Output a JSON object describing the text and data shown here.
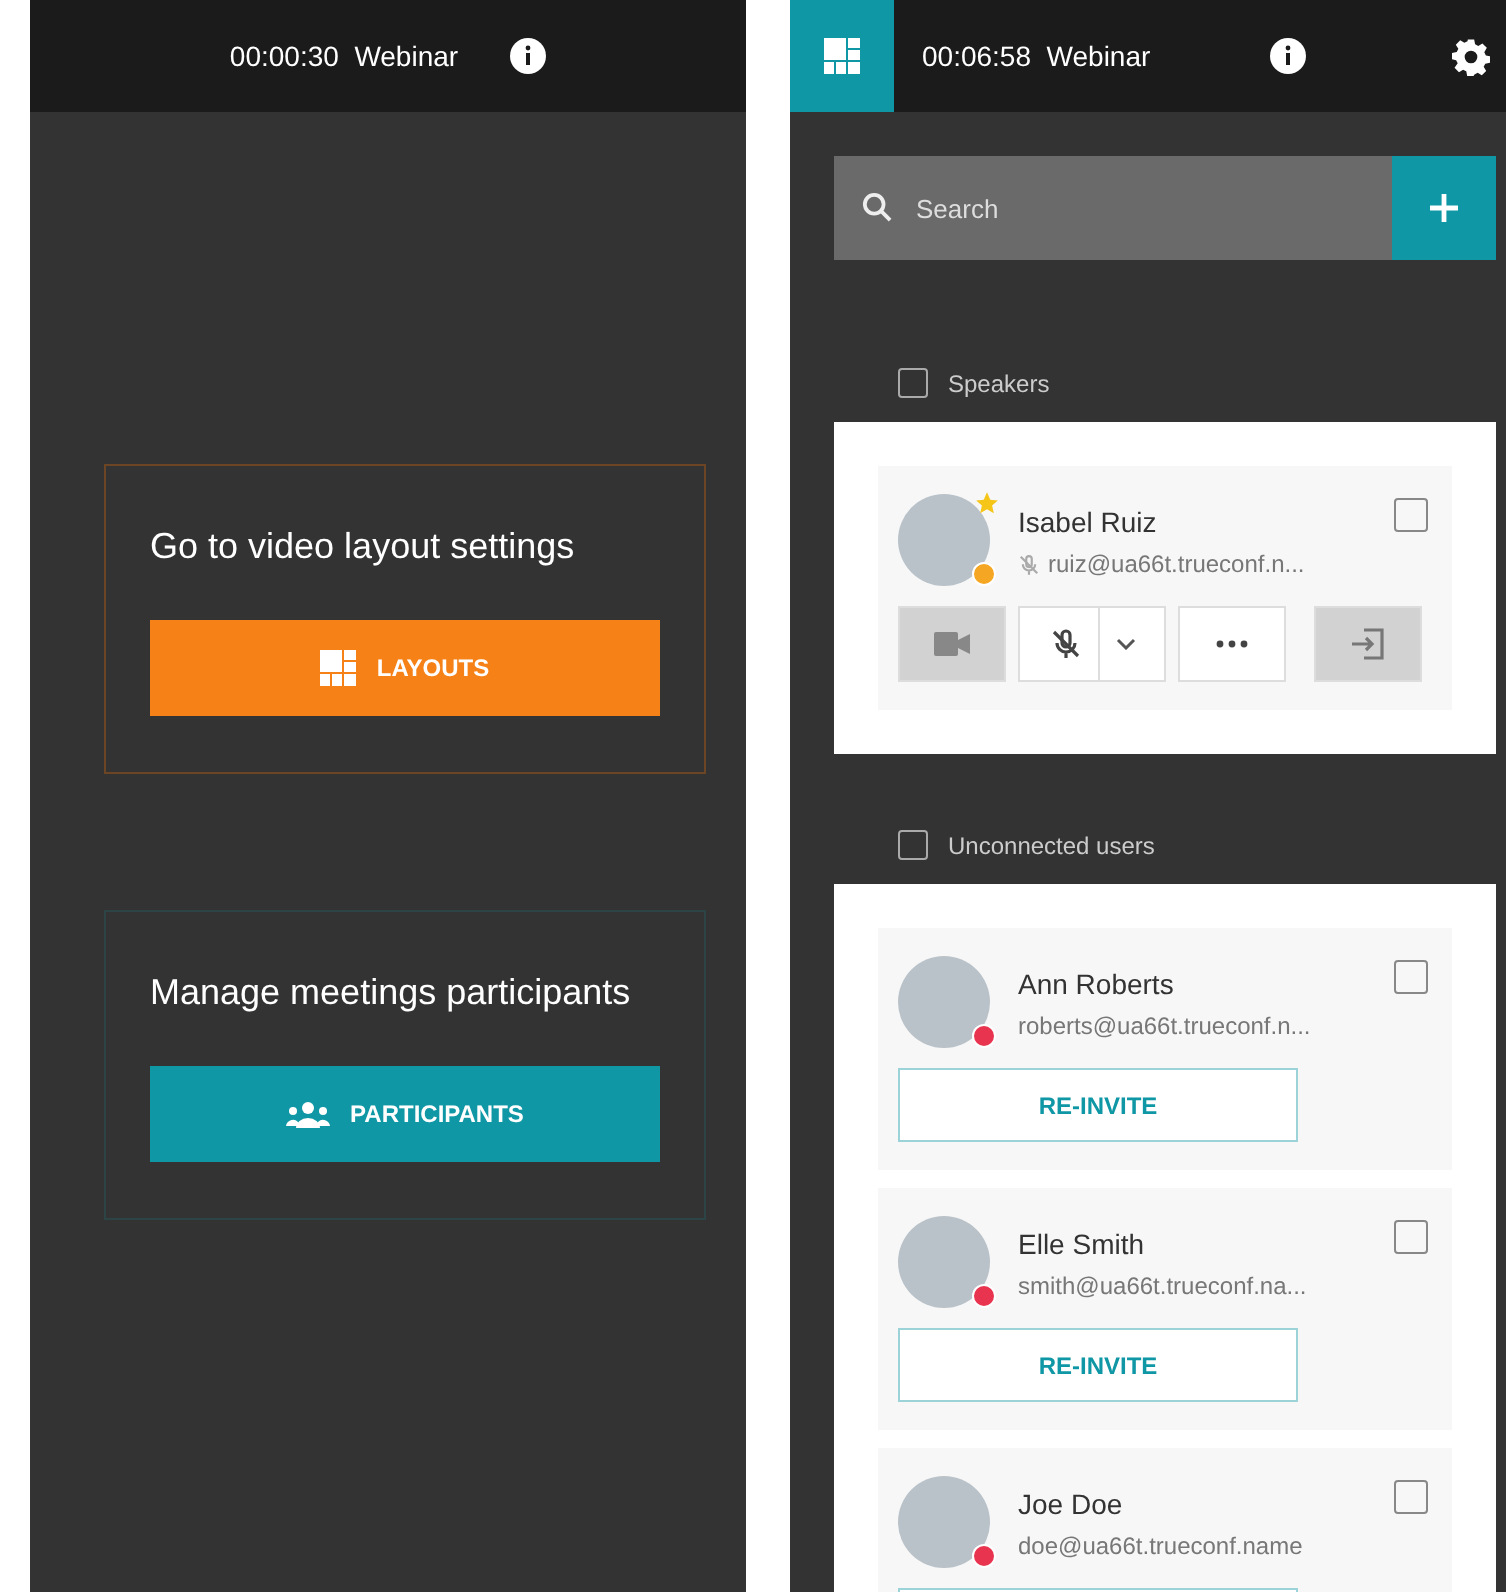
{
  "left_panel": {
    "header": {
      "timer": "00:00:30",
      "title": "Webinar"
    },
    "cards": [
      {
        "kind": "layouts",
        "text": "Go to video layout settings",
        "button": "LAYOUTS"
      },
      {
        "kind": "participants",
        "text": "Manage meetings participants",
        "button": "PARTICIPANTS"
      }
    ]
  },
  "right_panel": {
    "header": {
      "timer": "00:06:58",
      "title": "Webinar"
    },
    "search": {
      "placeholder": "Search"
    },
    "groups": [
      {
        "label": "Speakers",
        "checked": false,
        "participants": [
          {
            "kind": "speaker",
            "name": "Isabel Ruiz",
            "email": "ruiz@ua66t.trueconf.n...",
            "color": "#f5a623",
            "checked": false
          }
        ]
      },
      {
        "label": "Unconnected users",
        "checked": false,
        "participants": [
          {
            "kind": "unconnected",
            "name": "Ann Roberts",
            "email": "roberts@ua66t.trueconf.n...",
            "color": "#e8344e",
            "checked": false,
            "button": "RE-INVITE"
          },
          {
            "kind": "unconnected",
            "name": "Elle Smith",
            "email": "smith@ua66t.trueconf.na...",
            "color": "#e8344e",
            "checked": false,
            "button": "RE-INVITE"
          },
          {
            "kind": "unconnected",
            "name": "Joe Doe",
            "email": "doe@ua66t.trueconf.name",
            "color": "#e8344e",
            "checked": false
          }
        ]
      }
    ]
  }
}
